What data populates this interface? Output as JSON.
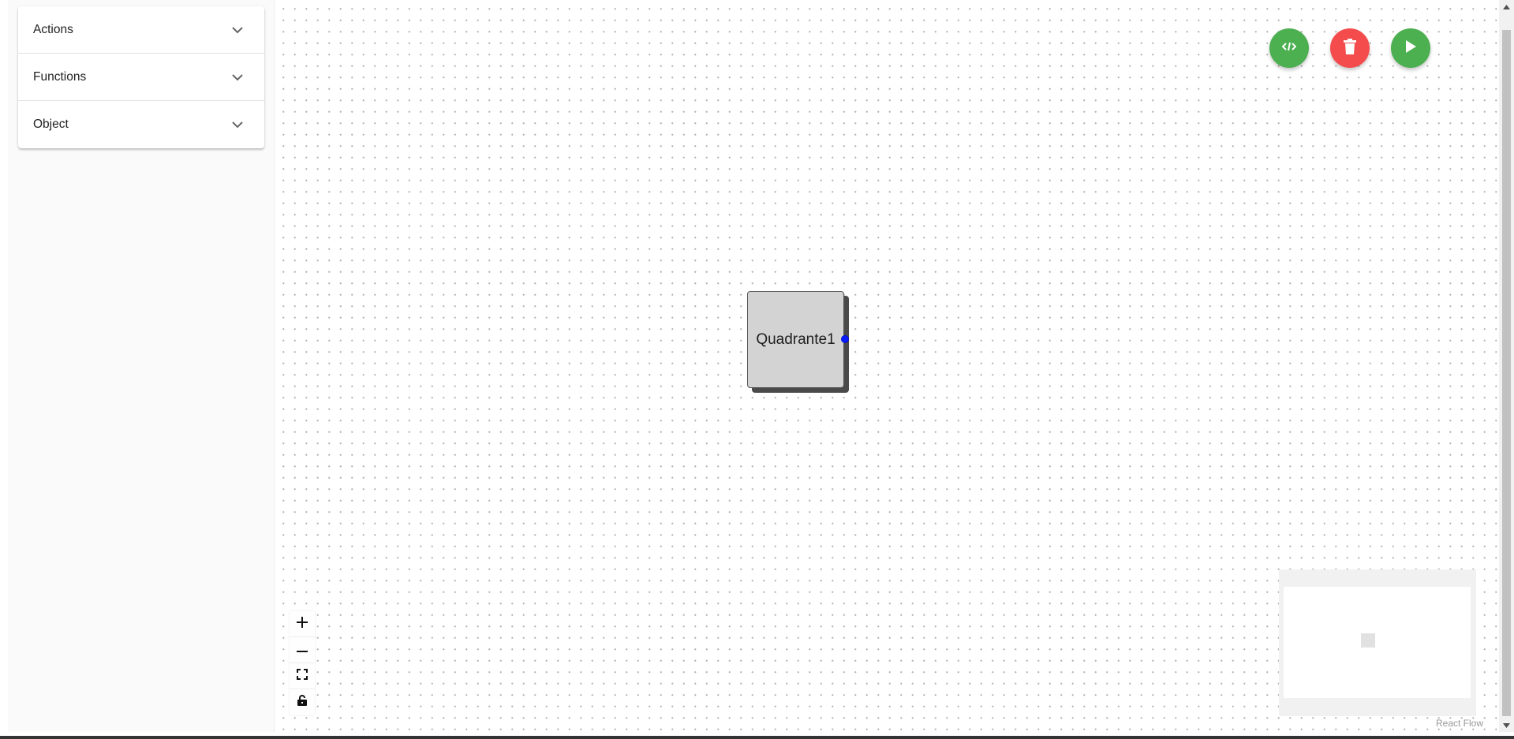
{
  "sidebar": {
    "items": [
      {
        "label": "Actions",
        "icon": "chevron-down-icon"
      },
      {
        "label": "Functions",
        "icon": "chevron-down-icon"
      },
      {
        "label": "Object",
        "icon": "chevron-down-icon"
      }
    ]
  },
  "toolbar": {
    "buttons": [
      {
        "name": "code",
        "icon": "code-icon",
        "color": "#4caf50"
      },
      {
        "name": "delete",
        "icon": "trash-icon",
        "color": "#f44c4c"
      },
      {
        "name": "run",
        "icon": "play-icon",
        "color": "#4caf50"
      }
    ]
  },
  "canvas": {
    "nodes": [
      {
        "label": "Quadrante1",
        "handle_color": "#0a1bff"
      }
    ]
  },
  "controls": {
    "buttons": [
      {
        "name": "zoom-in",
        "icon": "plus-icon"
      },
      {
        "name": "zoom-out",
        "icon": "minus-icon"
      },
      {
        "name": "fit-view",
        "icon": "fit-view-icon"
      },
      {
        "name": "lock",
        "icon": "lock-icon"
      }
    ]
  },
  "attribution": "React Flow"
}
